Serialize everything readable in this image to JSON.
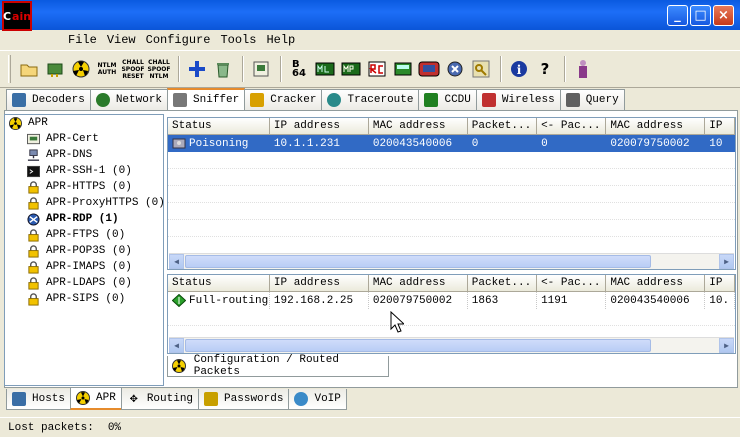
{
  "app": {
    "icon_text_prefix": "C",
    "icon_text_suffix": "ain"
  },
  "window_buttons": {
    "minimize": "_",
    "maximize": "□",
    "close": "×"
  },
  "menu": [
    "File",
    "View",
    "Configure",
    "Tools",
    "Help"
  ],
  "toolbar_icons": [
    "open-folder-icon",
    "network-card-icon",
    "apr-radiation-icon",
    "ntlm-auth-icon",
    "chall-spoof-reset-icon",
    "chall-spoof-ntlm-icon",
    "add-icon",
    "recycle-icon",
    "certificate-icon",
    "base64-icon",
    "lm-hash-icon",
    "mpr-icon",
    "rc-icon",
    "hash-calculator-icon",
    "tape-icon",
    "wireless-icon",
    "key-icon",
    "info-icon",
    "help-icon",
    "user-icon"
  ],
  "toolbar_labels": {
    "ntlm": "NTLM\nAUTH",
    "chall1": "CHALL\nSPOOF\nRESET",
    "chall2": "CHALL\nSPOOF\nNTLM",
    "b64": "B\n64"
  },
  "top_tabs": [
    {
      "label": "Decoders",
      "color": "#3a6ea5"
    },
    {
      "label": "Network",
      "color": "#2a7a2a"
    },
    {
      "label": "Sniffer",
      "color": "#777777"
    },
    {
      "label": "Cracker",
      "color": "#d8a000"
    },
    {
      "label": "Traceroute",
      "color": "#2a8a8a"
    },
    {
      "label": "CCDU",
      "color": "#208020"
    },
    {
      "label": "Wireless",
      "color": "#c03030"
    },
    {
      "label": "Query",
      "color": "#606060"
    }
  ],
  "tree": {
    "root": "APR",
    "items": [
      {
        "label": "APR-Cert",
        "icon": "certificate-icon",
        "bold": false
      },
      {
        "label": "APR-DNS",
        "icon": "dns-icon",
        "bold": false
      },
      {
        "label": "APR-SSH-1 (0)",
        "icon": "terminal-icon",
        "bold": false
      },
      {
        "label": "APR-HTTPS (0)",
        "icon": "lock-icon",
        "bold": false
      },
      {
        "label": "APR-ProxyHTTPS (0)",
        "icon": "lock-icon",
        "bold": false
      },
      {
        "label": "APR-RDP (1)",
        "icon": "rdp-icon",
        "bold": true
      },
      {
        "label": "APR-FTPS (0)",
        "icon": "lock-icon",
        "bold": false
      },
      {
        "label": "APR-POP3S (0)",
        "icon": "lock-icon",
        "bold": false
      },
      {
        "label": "APR-IMAPS (0)",
        "icon": "lock-icon",
        "bold": false
      },
      {
        "label": "APR-LDAPS (0)",
        "icon": "lock-icon",
        "bold": false
      },
      {
        "label": "APR-SIPS (0)",
        "icon": "lock-icon",
        "bold": false
      }
    ]
  },
  "upper_table": {
    "columns": [
      "Status",
      "IP address",
      "MAC address",
      "Packet...",
      "<- Pac...",
      "MAC address",
      "IP"
    ],
    "rows": [
      [
        "Poisoning",
        "10.1.1.231",
        "020043540006",
        "0",
        "0",
        "020079750002",
        "10"
      ]
    ]
  },
  "lower_table": {
    "columns": [
      "Status",
      "IP address",
      "MAC address",
      "Packet...",
      "<- Pac...",
      "MAC address",
      "IP"
    ],
    "rows": [
      [
        "Full-routing",
        "192.168.2.25",
        "020079750002",
        "1863",
        "1191",
        "020043540006",
        "10."
      ]
    ]
  },
  "config_tab": "Configuration / Routed Packets",
  "bottom_tabs": [
    "Hosts",
    "APR",
    "Routing",
    "Passwords",
    "VoIP"
  ],
  "status": {
    "label": "Lost packets:",
    "value": "0%"
  }
}
